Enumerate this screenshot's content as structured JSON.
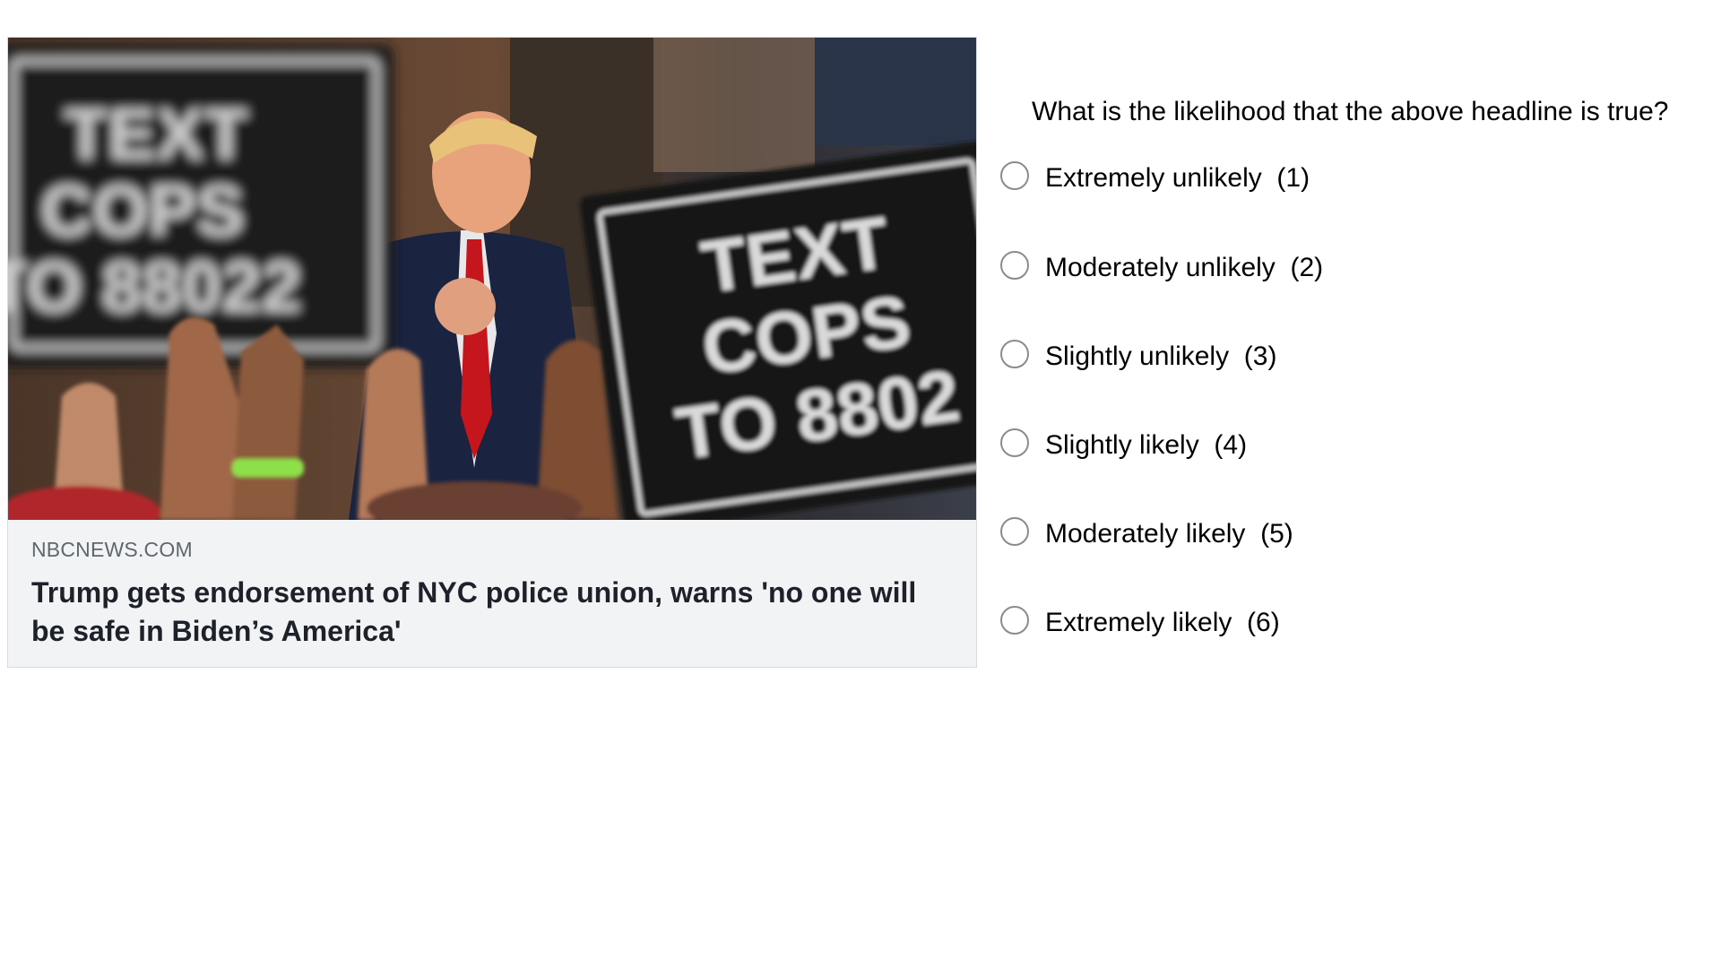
{
  "news_card": {
    "image": {
      "description_icon": "news-photo",
      "sign_left_lines": [
        "TEXT",
        "COPS",
        "TO 88022"
      ],
      "sign_right_lines": [
        "TEXT",
        "COPS",
        "TO 8802"
      ]
    },
    "source": "NBCNEWS.COM",
    "headline": "Trump gets endorsement of NYC police union, warns 'no one will be safe in Biden’s America'"
  },
  "survey": {
    "question": "What is the likelihood that the above headline is true?",
    "options": [
      {
        "label": "Extremely unlikely  (1)"
      },
      {
        "label": "Moderately unlikely  (2)"
      },
      {
        "label": "Slightly unlikely  (3)"
      },
      {
        "label": "Slightly likely  (4)"
      },
      {
        "label": "Moderately likely  (5)"
      },
      {
        "label": "Extremely likely  (6)"
      }
    ]
  },
  "colors": {
    "card_background": "#f2f3f5",
    "source_text": "#606770",
    "headline_text": "#1d2129",
    "radio_border": "#8b8b8b"
  }
}
